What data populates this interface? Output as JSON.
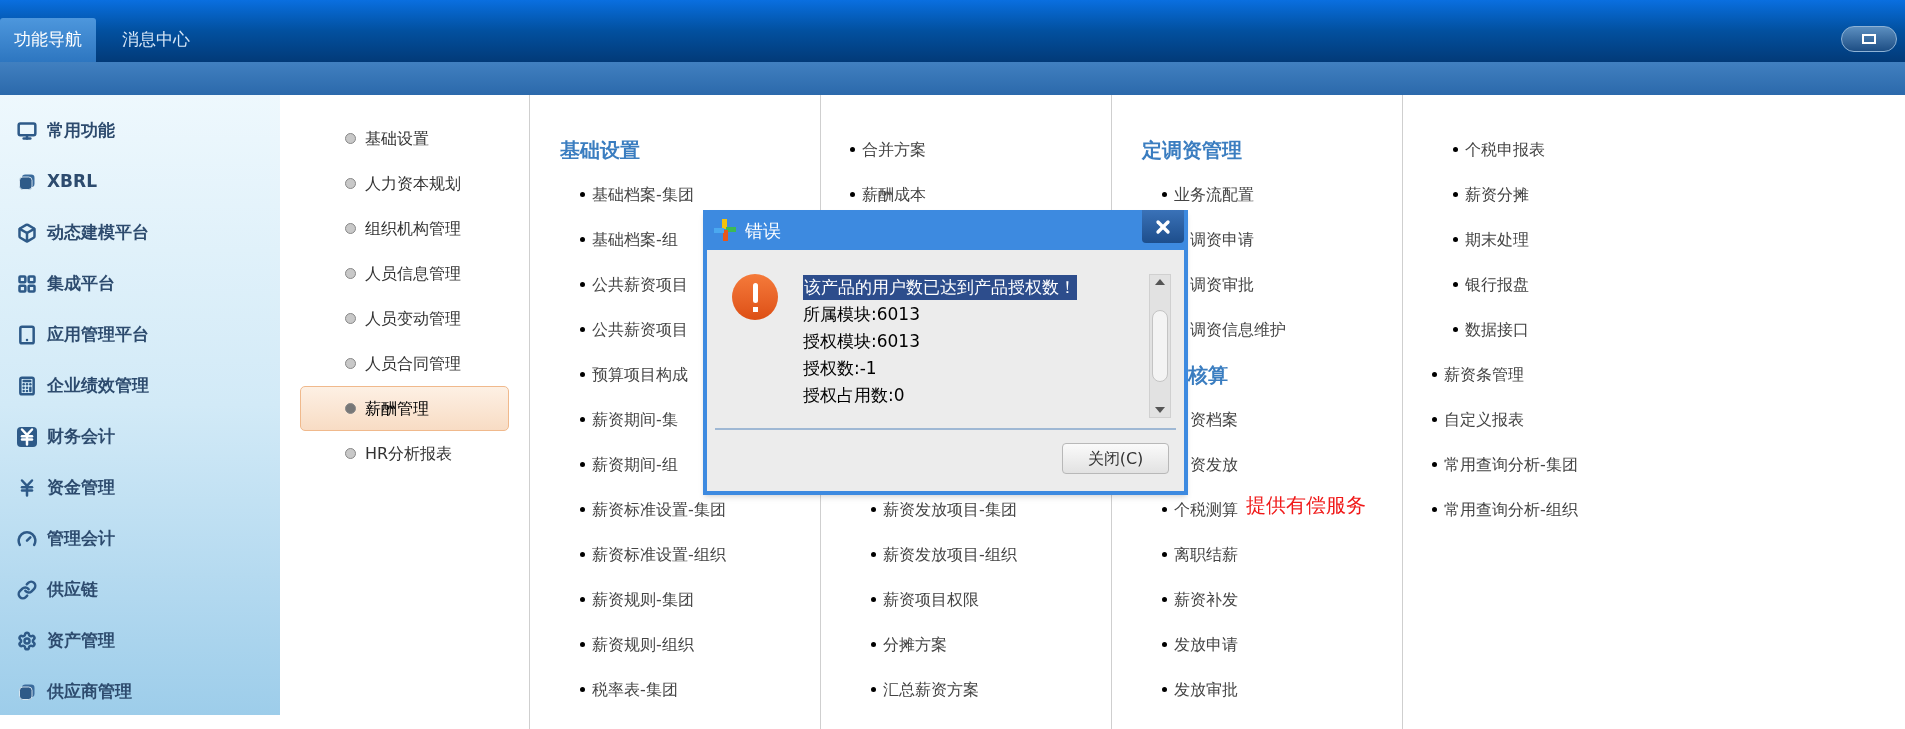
{
  "tabs": [
    {
      "label": "功能导航",
      "selected": true
    },
    {
      "label": "消息中心",
      "selected": false
    }
  ],
  "sidebar": {
    "items": [
      "常用功能",
      "XBRL",
      "动态建模平台",
      "集成平台",
      "应用管理平台",
      "企业绩效管理",
      "财务会计",
      "资金管理",
      "管理会计",
      "供应链",
      "资产管理",
      "供应商管理"
    ]
  },
  "submenu": {
    "items": [
      {
        "label": "基础设置",
        "selected": false
      },
      {
        "label": "人力资本规划",
        "selected": false
      },
      {
        "label": "组织机构管理",
        "selected": false
      },
      {
        "label": "人员信息管理",
        "selected": false
      },
      {
        "label": "人员变动管理",
        "selected": false
      },
      {
        "label": "人员合同管理",
        "selected": false
      },
      {
        "label": "薪酬管理",
        "selected": true
      },
      {
        "label": "HR分析报表",
        "selected": false
      }
    ]
  },
  "columns": [
    {
      "sections": [
        [
          {
            "kind": "heading",
            "text": "基础设置"
          },
          {
            "kind": "item",
            "text": "基础档案-集团"
          },
          {
            "kind": "item",
            "text": "基础档案-组"
          },
          {
            "kind": "item",
            "text": "公共薪资项目"
          },
          {
            "kind": "item",
            "text": "公共薪资项目"
          },
          {
            "kind": "item",
            "text": "预算项目构成"
          },
          {
            "kind": "item",
            "text": "薪资期间-集"
          },
          {
            "kind": "item",
            "text": "薪资期间-组"
          },
          {
            "kind": "item",
            "text": "薪资标准设置-集团"
          },
          {
            "kind": "item",
            "text": "薪资标准设置-组织"
          },
          {
            "kind": "item",
            "text": "薪资规则-集团"
          },
          {
            "kind": "item",
            "text": "薪资规则-组织"
          },
          {
            "kind": "item",
            "text": "税率表-集团"
          }
        ]
      ]
    },
    {
      "sections": [
        [
          {
            "kind": "top_item",
            "text": "合并方案"
          },
          {
            "kind": "top_item",
            "text": "薪酬成本"
          }
        ],
        [
          {
            "kind": "item",
            "text": "薪资发放项目-集团"
          },
          {
            "kind": "item",
            "text": "薪资发放项目-组织"
          },
          {
            "kind": "item",
            "text": "薪资项目权限"
          },
          {
            "kind": "item",
            "text": "分摊方案"
          },
          {
            "kind": "item",
            "text": "汇总薪资方案"
          }
        ]
      ]
    },
    {
      "sections": [
        [
          {
            "kind": "heading",
            "text": "定调资管理"
          },
          {
            "kind": "item",
            "text": "业务流配置"
          },
          {
            "kind": "item",
            "text": "调资申请",
            "partial": true
          },
          {
            "kind": "item",
            "text": "调资审批",
            "partial": true
          },
          {
            "kind": "item",
            "text": "调资信息维护",
            "partial": true
          },
          {
            "kind": "heading",
            "text": "核算",
            "partial": true
          },
          {
            "kind": "item",
            "text": "资档案",
            "partial": true
          },
          {
            "kind": "item",
            "text": "资发放",
            "partial": true
          },
          {
            "kind": "item",
            "text": "个税测算"
          },
          {
            "kind": "item",
            "text": "离职结薪"
          },
          {
            "kind": "item",
            "text": "薪资补发"
          },
          {
            "kind": "item",
            "text": "发放申请"
          },
          {
            "kind": "item",
            "text": "发放审批"
          }
        ]
      ]
    },
    {
      "sections": [
        [
          {
            "kind": "item",
            "text": "个税申报表"
          },
          {
            "kind": "item",
            "text": "薪资分摊"
          },
          {
            "kind": "item",
            "text": "期末处理"
          },
          {
            "kind": "item",
            "text": "银行报盘"
          },
          {
            "kind": "item",
            "text": "数据接口"
          },
          {
            "kind": "top_item",
            "text": "薪资条管理"
          },
          {
            "kind": "top_item",
            "text": "自定义报表"
          },
          {
            "kind": "top_item",
            "text": "常用查询分析-集团"
          },
          {
            "kind": "top_item",
            "text": "常用查询分析-组织"
          }
        ]
      ]
    }
  ],
  "note": "提供有偿服务",
  "dialog": {
    "title": "错误",
    "lines": [
      {
        "text": "该产品的用户数已达到产品授权数！",
        "selected": true
      },
      {
        "text": "所属模块:6013",
        "selected": false
      },
      {
        "text": "授权模块:6013",
        "selected": false
      },
      {
        "text": "授权数:-1",
        "selected": false
      },
      {
        "text": "授权占用数:0",
        "selected": false
      }
    ],
    "button": "关闭(C)"
  }
}
